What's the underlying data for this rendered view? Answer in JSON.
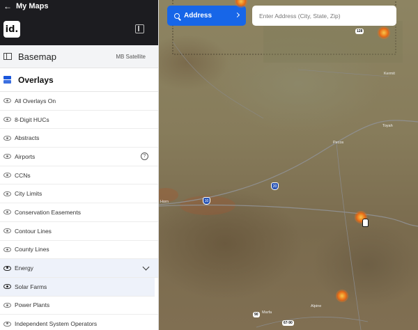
{
  "topbar": {
    "back_label": "My Maps",
    "logo_text": "id."
  },
  "basemap": {
    "label": "Basemap",
    "value": "MB Satellite"
  },
  "overlays": {
    "label": "Overlays",
    "items": [
      {
        "label": "All Overlays On"
      },
      {
        "label": "8-Digit HUCs"
      },
      {
        "label": "Abstracts"
      },
      {
        "label": "Airports"
      },
      {
        "label": "CCNs"
      },
      {
        "label": "City Limits"
      },
      {
        "label": "Conservation Easements"
      },
      {
        "label": "Contour Lines"
      },
      {
        "label": "County Lines"
      },
      {
        "label": "Energy"
      },
      {
        "label": "Solar Farms"
      },
      {
        "label": "Power Plants"
      },
      {
        "label": "Independent System Operators"
      }
    ],
    "help_symbol": "?"
  },
  "search": {
    "button_label": "Address",
    "placeholder": "Enter Address (City, State, Zip)"
  },
  "map": {
    "towns": [
      "Kermit",
      "Pecos",
      "Toyah",
      "Horn",
      "Marfa",
      "Alpine"
    ],
    "shields": [
      "128",
      "20",
      "10",
      "90",
      "67-90"
    ],
    "colors": {
      "accent": "#1766e8",
      "sidebar_dark": "#1c1c20",
      "marker": "#e8721a"
    }
  }
}
